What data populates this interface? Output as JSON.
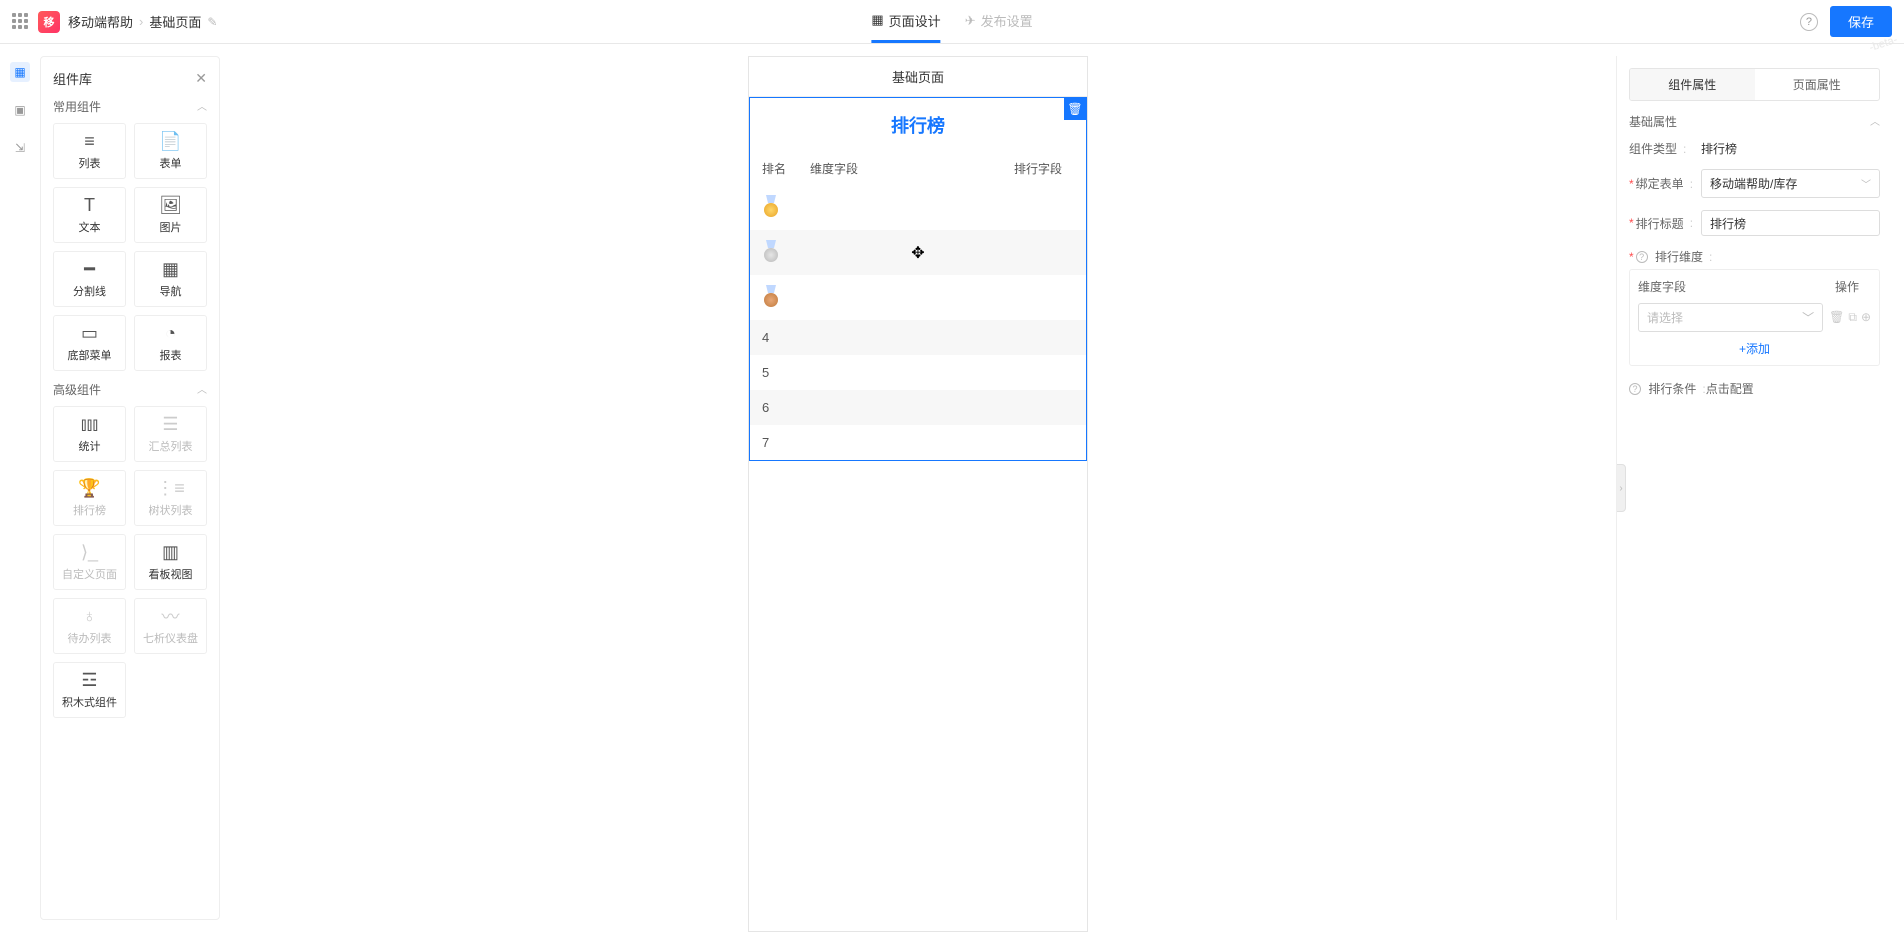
{
  "topbar": {
    "app_logo_text": "移",
    "breadcrumb": [
      "移动端帮助",
      "基础页面"
    ],
    "tabs": {
      "design": "页面设计",
      "publish": "发布设置"
    },
    "save": "保存"
  },
  "library": {
    "title": "组件库",
    "sections": {
      "common": {
        "title": "常用组件",
        "items": [
          "列表",
          "表单",
          "文本",
          "图片",
          "分割线",
          "导航",
          "底部菜单",
          "报表"
        ]
      },
      "advanced": {
        "title": "高级组件",
        "items": [
          "统计",
          "汇总列表",
          "排行榜",
          "树状列表",
          "自定义页面",
          "看板视图",
          "待办列表",
          "七析仪表盘",
          "积木式组件"
        ]
      }
    }
  },
  "canvas": {
    "page_title": "基础页面",
    "rank": {
      "title": "排行榜",
      "columns": [
        "排名",
        "维度字段",
        "排行字段"
      ],
      "rows": [
        "1",
        "2",
        "3",
        "4",
        "5",
        "6",
        "7"
      ]
    }
  },
  "props": {
    "tabs": {
      "component": "组件属性",
      "page": "页面属性"
    },
    "section_basic": "基础属性",
    "type_label": "组件类型",
    "type_value": "排行榜",
    "form_label": "绑定表单",
    "form_value": "移动端帮助/库存",
    "title_label": "排行标题",
    "title_value": "排行榜",
    "dim_label": "排行维度",
    "dim_col_field": "维度字段",
    "dim_col_ops": "操作",
    "dim_placeholder": "请选择",
    "add_text": "+添加",
    "cond_label": "排行条件",
    "cond_value": "点击配置"
  },
  "watermark": "-beta-"
}
